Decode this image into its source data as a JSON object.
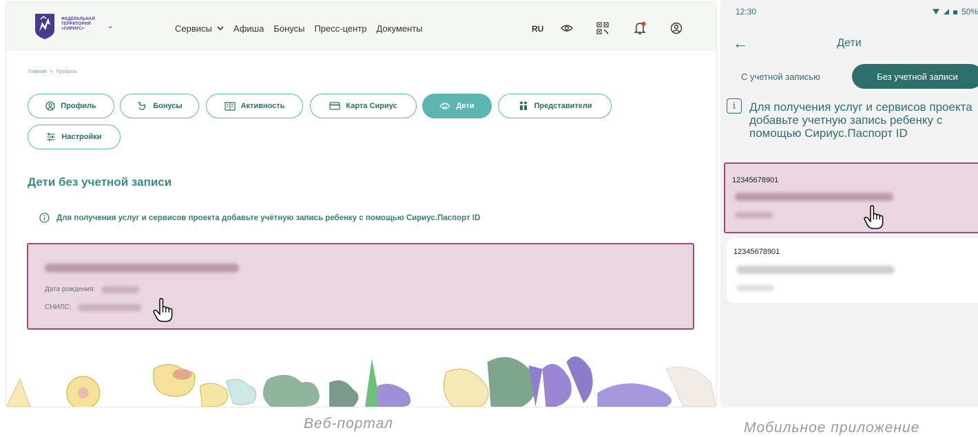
{
  "web": {
    "logo_text": [
      "ФЕДЕРАЛЬНАЯ",
      "ТЕРРИТОРИЯ",
      "«СИРИУС»"
    ],
    "nav": [
      {
        "label": "Сервисы",
        "has_dropdown": true
      },
      {
        "label": "Афиша"
      },
      {
        "label": "Бонусы"
      },
      {
        "label": "Пресс-центр"
      },
      {
        "label": "Документы"
      }
    ],
    "lang": "RU",
    "breadcrumb": {
      "home": "Главная",
      "separator": ">",
      "current": "Профиль"
    },
    "tabs": [
      {
        "label": "Профиль",
        "icon": "user-circle-icon"
      },
      {
        "label": "Бонусы",
        "icon": "bonus-icon"
      },
      {
        "label": "Активность",
        "icon": "activity-icon"
      },
      {
        "label": "Карта Сириус",
        "icon": "card-icon"
      },
      {
        "label": "Дети",
        "icon": "children-icon",
        "active": true
      },
      {
        "label": "Представители",
        "icon": "representatives-icon"
      },
      {
        "label": "Настройки",
        "icon": "settings-icon"
      }
    ],
    "section_title": "Дети без учетной записи",
    "info_text": "Для получения услуг и сервисов проекта добавьте учётную запись ребенку с помощью Сириус.Паспорт ID",
    "child_card": {
      "birth_label": "Дата рождения:",
      "snils_label": "СНИЛС:"
    },
    "caption": "Веб-портал"
  },
  "mobile": {
    "status_time": "12:30",
    "battery": "50%",
    "title": "Дети",
    "tab_with_account": "С учетной записью",
    "tab_without_account": "Без учетной записи",
    "info_text": "Для получения услуг и сервисов проекта добавьте учетную запись ребенку с помощью Сириус.Паспорт ID",
    "children": [
      {
        "id": "12345678901"
      },
      {
        "id": "12345678901"
      }
    ],
    "caption": "Мобильное приложение"
  },
  "colors": {
    "accent": "#5cb5b1",
    "accent_dark": "#2d6e6b",
    "highlight_fill": "#ead6de",
    "highlight_border": "#a3497a"
  }
}
